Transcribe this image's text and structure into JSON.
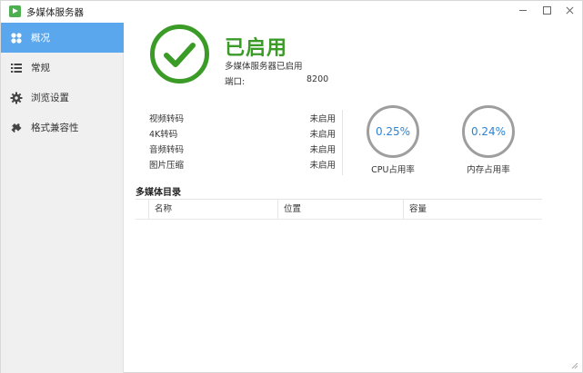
{
  "window": {
    "title": "多媒体服务器"
  },
  "sidebar": {
    "items": [
      {
        "label": "概况",
        "icon": "grid-icon",
        "active": true
      },
      {
        "label": "常规",
        "icon": "list-icon",
        "active": false
      },
      {
        "label": "浏览设置",
        "icon": "gear-icon",
        "active": false
      },
      {
        "label": "格式兼容性",
        "icon": "puzzle-icon",
        "active": false
      }
    ]
  },
  "status": {
    "title": "已启用",
    "subtitle": "多媒体服务器已启用",
    "port_label": "端口:",
    "port_value": "8200"
  },
  "features": [
    {
      "name": "视频转码",
      "status": "未启用"
    },
    {
      "name": "4K转码",
      "status": "未启用"
    },
    {
      "name": "音频转码",
      "status": "未启用"
    },
    {
      "name": "图片压缩",
      "status": "未启用"
    }
  ],
  "gauges": {
    "cpu": {
      "value": "0.25%",
      "label": "CPU占用率"
    },
    "memory": {
      "value": "0.24%",
      "label": "内存占用率"
    }
  },
  "media_dirs": {
    "title": "多媒体目录",
    "columns": [
      "名称",
      "位置",
      "容量"
    ]
  },
  "colors": {
    "accent": "#5aa7ee",
    "success": "#3a9b27",
    "gauge_text": "#2f83d3",
    "gauge_ring": "#9e9e9e"
  }
}
